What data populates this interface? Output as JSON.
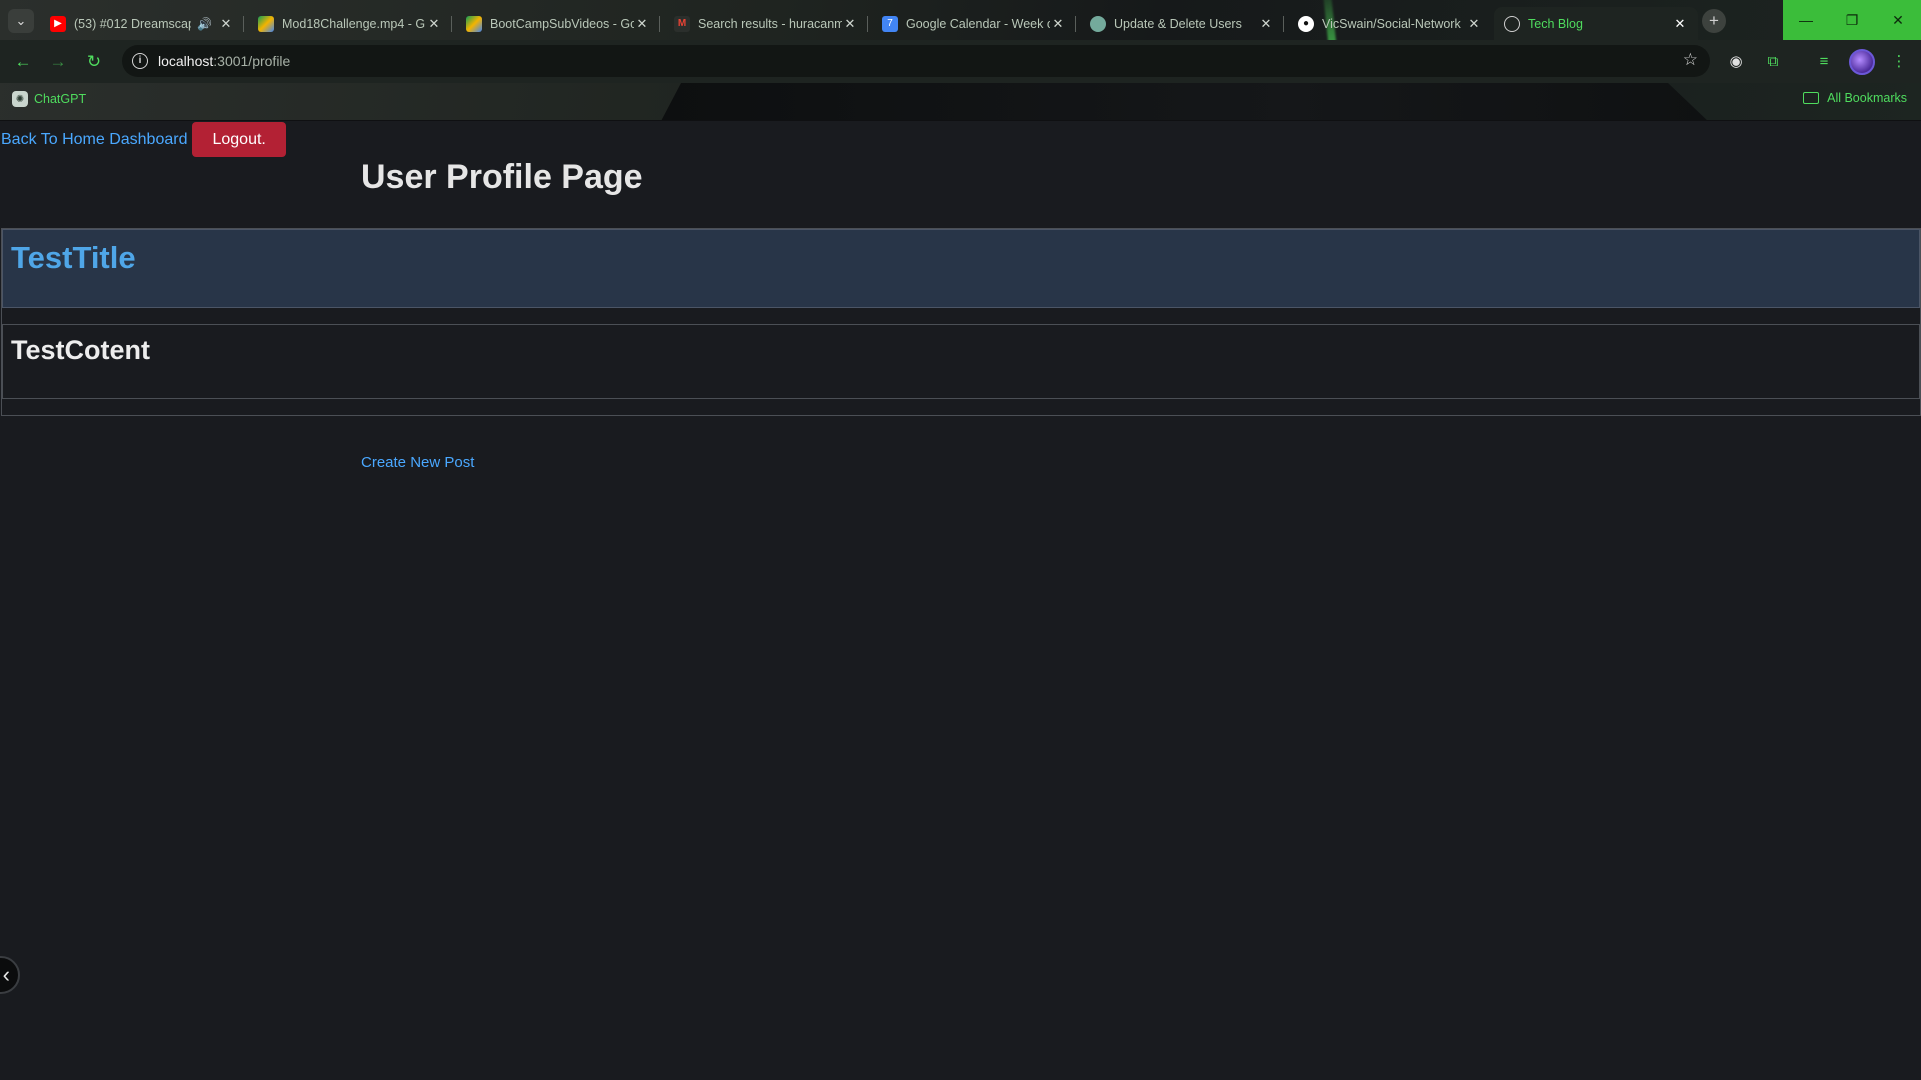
{
  "browser": {
    "tabs": [
      {
        "title": "(53) #012 Dreamscape",
        "favicon": "youtube-icon",
        "color": "#ff0000"
      },
      {
        "title": "Mod18Challenge.mp4 - G",
        "favicon": "google-drive-icon",
        "color": "#f4b400"
      },
      {
        "title": "BootCampSubVideos - Go",
        "favicon": "google-drive-icon",
        "color": "#f4b400"
      },
      {
        "title": "Search results - huracanm",
        "favicon": "gmail-icon",
        "color": "#ea4335"
      },
      {
        "title": "Google Calendar - Week o",
        "favicon": "google-calendar-icon",
        "color": "#4285f4"
      },
      {
        "title": "Update & Delete Users",
        "favicon": "chatgpt-icon",
        "color": "#74aa9c"
      },
      {
        "title": "VicSwain/Social-Network",
        "favicon": "github-icon",
        "color": "#ffffff"
      },
      {
        "title": "Tech Blog",
        "favicon": "globe-icon",
        "color": "#cfcfcf",
        "active": true
      }
    ],
    "url_host": "localhost",
    "url_path": ":3001/profile",
    "bookmarks": {
      "chatgpt": "ChatGPT",
      "all": "All Bookmarks"
    },
    "accent": "#4fdc5e"
  },
  "page": {
    "home_link": "Back To Home Dashboard",
    "logout_label": "Logout.",
    "title": "User Profile Page",
    "posts": [
      {
        "title": "TestTitle",
        "content": "TestCotent"
      }
    ],
    "create_link": "Create New Post"
  }
}
